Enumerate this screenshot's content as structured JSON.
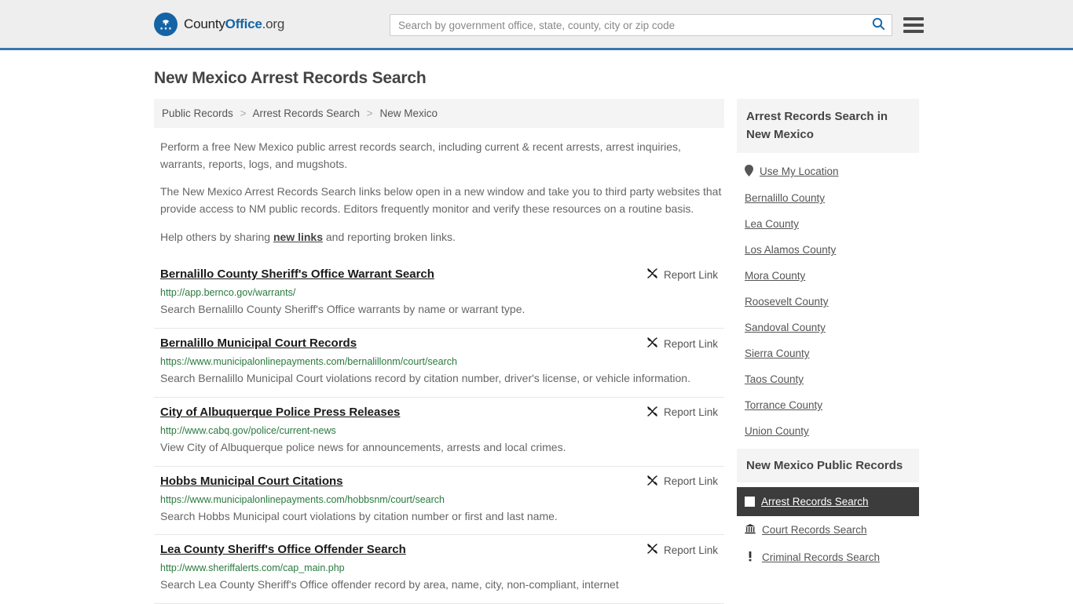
{
  "header": {
    "brand": {
      "part1": "County",
      "part2": "Office",
      "part3": ".org",
      "logo_icon": "eagle-seal-icon"
    },
    "search": {
      "placeholder": "Search by government office, state, county, city or zip code",
      "value": ""
    },
    "search_icon": "search-icon",
    "menu_icon": "hamburger-menu-icon"
  },
  "page": {
    "title": "New Mexico Arrest Records Search"
  },
  "breadcrumb": {
    "items": [
      {
        "label": "Public Records"
      },
      {
        "label": "Arrest Records Search"
      },
      {
        "label": "New Mexico"
      }
    ],
    "separator": ">"
  },
  "intro": {
    "p1": "Perform a free New Mexico public arrest records search, including current & recent arrests, arrest inquiries, warrants, reports, logs, and mugshots.",
    "p2": "The New Mexico Arrest Records Search links below open in a new window and take you to third party websites that provide access to NM public records. Editors frequently monitor and verify these resources on a routine basis.",
    "p3_before": "Help others by sharing ",
    "p3_link": "new links",
    "p3_after": " and reporting broken links."
  },
  "results": {
    "report_label": "Report Link",
    "report_icon": "broken-link-icon",
    "items": [
      {
        "title": "Bernalillo County Sheriff's Office Warrant Search",
        "url": "http://app.bernco.gov/warrants/",
        "desc": "Search Bernalillo County Sheriff's Office warrants by name or warrant type."
      },
      {
        "title": "Bernalillo Municipal Court Records",
        "url": "https://www.municipalonlinepayments.com/bernalillonm/court/search",
        "desc": "Search Bernalillo Municipal Court violations record by citation number, driver's license, or vehicle information."
      },
      {
        "title": "City of Albuquerque Police Press Releases",
        "url": "http://www.cabq.gov/police/current-news",
        "desc": "View City of Albuquerque police news for announcements, arrests and local crimes."
      },
      {
        "title": "Hobbs Municipal Court Citations",
        "url": "https://www.municipalonlinepayments.com/hobbsnm/court/search",
        "desc": "Search Hobbs Municipal court violations by citation number or first and last name."
      },
      {
        "title": "Lea County Sheriff's Office Offender Search",
        "url": "http://www.sheriffalerts.com/cap_main.php",
        "desc": "Search Lea County Sheriff's Office offender record by area, name, city, non-compliant, internet"
      }
    ]
  },
  "sidebar": {
    "header": "Arrest Records Search in New Mexico",
    "use_my_location": {
      "label": "Use My Location",
      "icon": "map-pin-icon"
    },
    "counties": [
      {
        "label": "Bernalillo County"
      },
      {
        "label": "Lea County"
      },
      {
        "label": "Los Alamos County"
      },
      {
        "label": "Mora County"
      },
      {
        "label": "Roosevelt County"
      },
      {
        "label": "Sandoval County"
      },
      {
        "label": "Sierra County"
      },
      {
        "label": "Taos County"
      },
      {
        "label": "Torrance County"
      },
      {
        "label": "Union County"
      }
    ],
    "records_header": "New Mexico Public Records",
    "records": [
      {
        "label": "Arrest Records Search",
        "icon": "square-icon",
        "active": true
      },
      {
        "label": "Court Records Search",
        "icon": "courthouse-icon",
        "active": false
      },
      {
        "label": "Criminal Records Search",
        "icon": "exclamation-icon",
        "active": false
      }
    ]
  },
  "colors": {
    "accent_blue": "#1464a5",
    "header_border": "#3a76ae",
    "url_green": "#2a7a3f",
    "active_bg": "#3c3c3c",
    "panel_gray": "#f4f4f4"
  }
}
